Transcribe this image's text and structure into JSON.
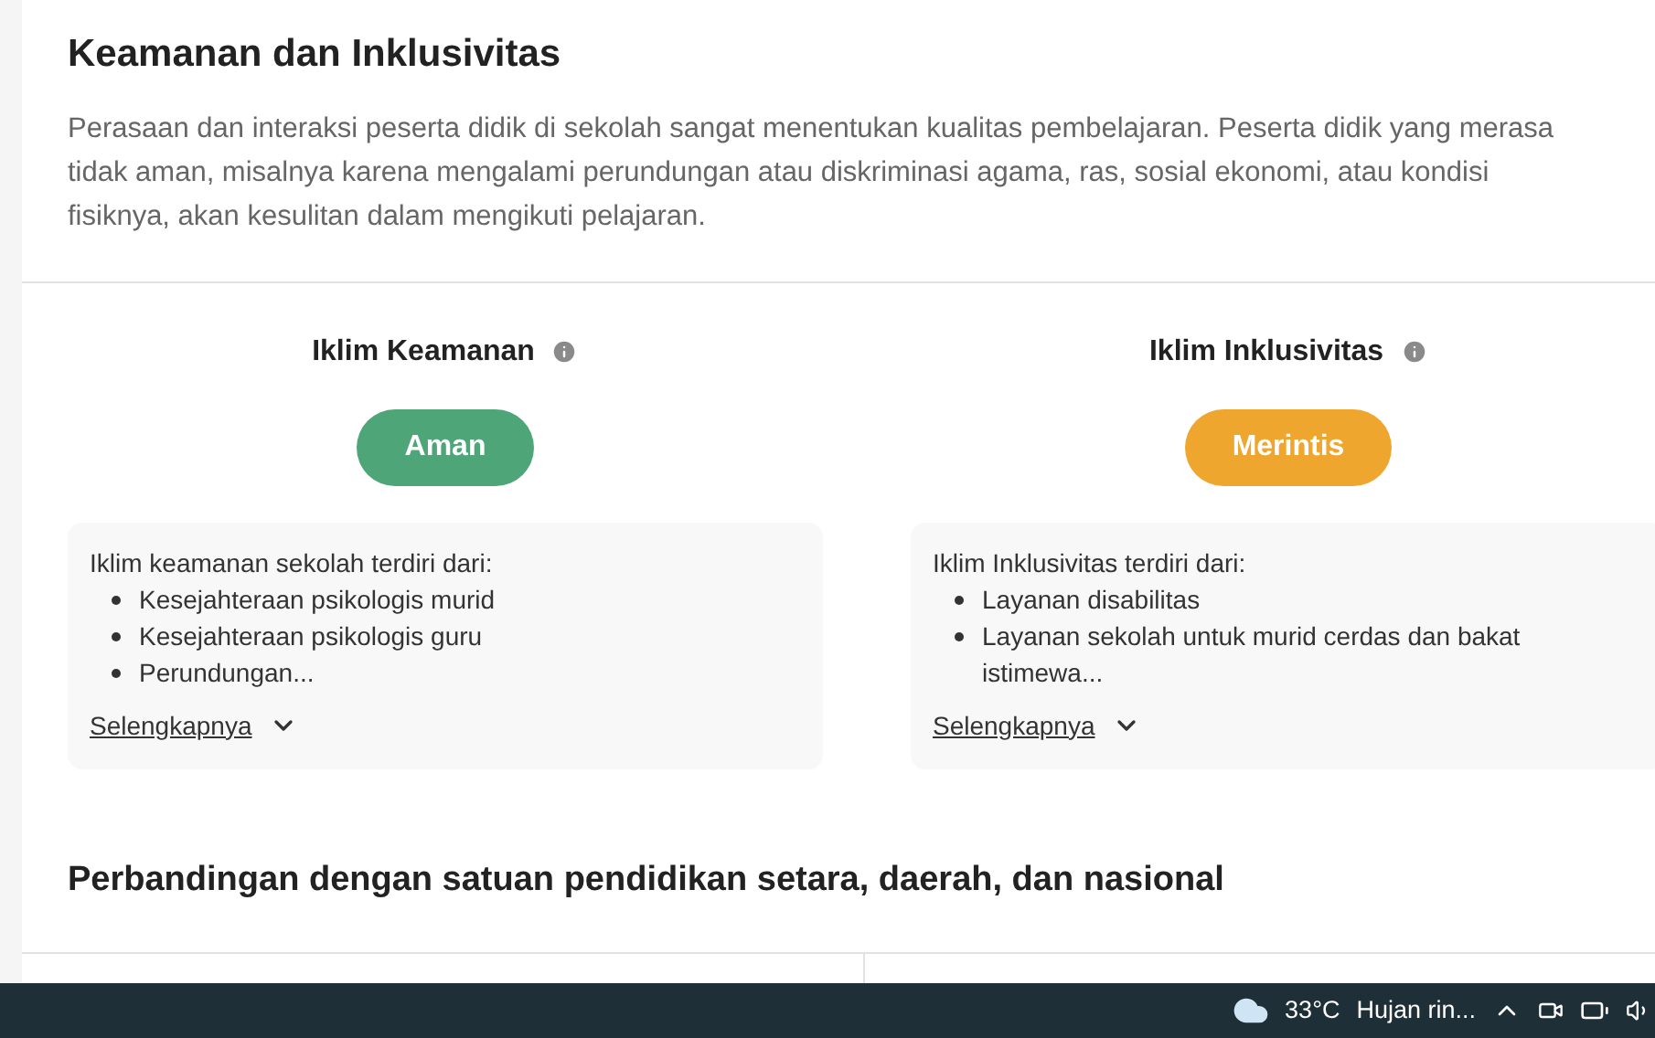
{
  "section": {
    "title": "Keamanan dan Inklusivitas",
    "description": "Perasaan dan interaksi peserta didik di sekolah sangat menentukan kualitas pembelajaran. Peserta didik yang merasa tidak aman, misalnya karena mengalami perundungan atau diskriminasi agama, ras, sosial ekonomi, atau kondisi fisiknya, akan kesulitan dalam mengikuti pelajaran."
  },
  "climates": [
    {
      "title": "Iklim Keamanan",
      "badge": "Aman",
      "color": "#4ea577",
      "intro": "Iklim keamanan sekolah terdiri dari:",
      "items": [
        "Kesejahteraan psikologis murid",
        "Kesejahteraan psikologis guru",
        "Perundungan..."
      ],
      "link": "Selengkapnya",
      "expanded": false
    },
    {
      "title": "Iklim Inklusivitas",
      "badge": "Merintis",
      "color": "#eea62e",
      "intro": "Iklim Inklusivitas terdiri dari:",
      "items": [
        "Layanan disabilitas",
        "Layanan sekolah untuk murid cerdas dan bakat istimewa..."
      ],
      "link": "Selengkapnya",
      "expanded": false
    }
  ],
  "comparison": {
    "title": "Perbandingan dengan satuan pendidikan setara, daerah, dan nasional"
  },
  "taskbar": {
    "temperature": "33°C",
    "weather": "Hujan rin..."
  }
}
